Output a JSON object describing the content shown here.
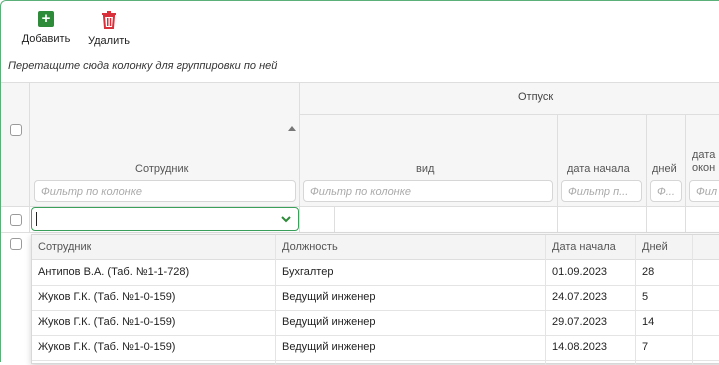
{
  "toolbar": {
    "add_label": "Добавить",
    "delete_label": "Удалить",
    "add_icon": "plus-icon",
    "delete_icon": "trash-icon",
    "add_color": "#2e8b3a",
    "delete_color": "#d9303b"
  },
  "group_panel": {
    "hint": "Перетащите сюда колонку для группировки по ней"
  },
  "grid": {
    "band_header": "Отпуск",
    "columns": {
      "employee": "Сотрудник",
      "type": "вид",
      "start_date_line1": "дата начала",
      "days": "дней",
      "end_date_line1": "дата",
      "end_date_line2": "окон"
    },
    "filters": {
      "employee": "Фильтр по колонке",
      "type": "Фильтр по колонке",
      "start_date": "Фильтр п...",
      "days": "Ф...",
      "end_date": "Фил"
    }
  },
  "editor": {
    "value": "",
    "accent": "#3aa05a"
  },
  "dropdown": {
    "headers": [
      "Сотрудник",
      "Должность",
      "Дата начала",
      "Дней"
    ],
    "rows": [
      [
        "Антипов В.А. (Таб. №1-1-728)",
        "Бухгалтер",
        "01.09.2023",
        "28"
      ],
      [
        "Жуков Г.К. (Таб. №1-0-159)",
        "Ведущий инженер",
        "24.07.2023",
        "5"
      ],
      [
        "Жуков Г.К. (Таб. №1-0-159)",
        "Ведущий инженер",
        "29.07.2023",
        "14"
      ],
      [
        "Жуков Г.К. (Таб. №1-0-159)",
        "Ведущий инженер",
        "14.08.2023",
        "7"
      ]
    ]
  }
}
